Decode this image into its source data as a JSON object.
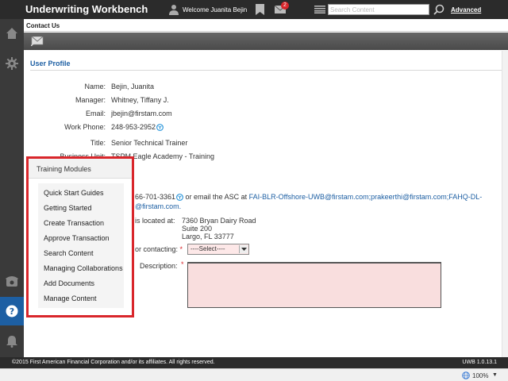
{
  "header": {
    "app_title": "Underwriting Workbench",
    "welcome": "Welcome Juanita Bejin",
    "mail_count": "2",
    "search_placeholder": "Search Content",
    "advanced_label": "Advanced"
  },
  "page": {
    "breadcrumb": "Contact Us",
    "section_title": "User Profile"
  },
  "profile": {
    "name_label": "Name:",
    "name_value": "Bejin, Juanita",
    "manager_label": "Manager:",
    "manager_value": "Whitney, Tiffany J.",
    "email_label": "Email:",
    "email_value": "jbejin@firstam.com",
    "phone_label": "Work Phone:",
    "phone_value": "248-953-2952",
    "title_label": "Title:",
    "title_value": "Senior Technical Trainer",
    "business_unit_label": "Business Unit:",
    "business_unit_value": "TSPM Eagle Academy - Training"
  },
  "support": {
    "phone_partial": "66-701-3361",
    "email_text": " or email the ASC at ",
    "email_link_line1": "FAI-BLR-Offshore-UWB@firstam.com;prakeerthi@firstam.com;FAHQ-DL-",
    "email_link_line2": "@firstam.com.",
    "located_label": "is located at:",
    "address_line1": "7360 Bryan Dairy Road",
    "address_line2": "Suite 200",
    "address_line3": "Largo, FL 33777",
    "reason_label": "or contacting:",
    "reason_select": "----Select----",
    "description_label": "Description:",
    "required_mark": "*"
  },
  "training": {
    "title": "Training Modules",
    "items": [
      "Quick Start Guides",
      "Getting Started",
      "Create Transaction",
      "Approve Transaction",
      "Search Content",
      "Managing Collaborations",
      "Add Documents",
      "Manage Content"
    ]
  },
  "footer": {
    "copyright": "©2015 First American Financial Corporation and/or its affiliates. All rights reserved.",
    "version": "UWB 1.0.13.1"
  },
  "statusbar": {
    "zoom": "100%",
    "zoom_arrow": "▼"
  },
  "colors": {
    "topbar": "#2b2b2b",
    "accent_blue": "#1d5fa3",
    "highlight_red": "#d9262b",
    "required_field_bg": "#f9dede"
  },
  "icons": {
    "rail": [
      "home-icon",
      "gear-icon",
      "phone-icon",
      "help-icon",
      "bell-icon"
    ],
    "header": [
      "user-icon",
      "bookmark-icon",
      "mail-icon",
      "menu-icon",
      "search-icon"
    ]
  }
}
